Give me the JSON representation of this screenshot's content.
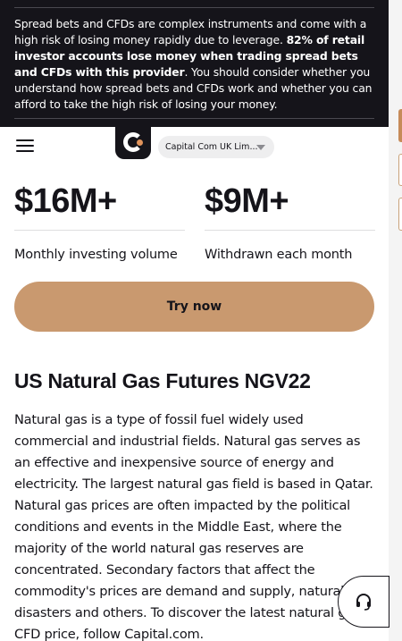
{
  "risk_banner": {
    "text_before": "Spread bets and CFDs are complex instruments and come with a high risk of losing money rapidly due to leverage. ",
    "bold_text": "82% of retail investor accounts lose money when trading spread bets and CFDs with this provider",
    "text_after": ". You should consider whether you understand how spread bets and CFDs work and whether you can afford to take the high risk of losing your money."
  },
  "header": {
    "menu_icon": "hamburger-menu-icon",
    "logo_icon": "capital-com-logo",
    "entity_select": "Capital Com UK Lim..."
  },
  "stats": [
    {
      "value": "$16M+",
      "label": "Monthly investing volume"
    },
    {
      "value": "$9M+",
      "label": "Withdrawn each month"
    }
  ],
  "cta": {
    "label": "Try now"
  },
  "article": {
    "title": "US Natural Gas Futures NGV22",
    "body": "Natural gas is a type of fossil fuel widely used commercial and industrial fields. Natural gas serves as an effective and inexpensive source of energy and electricity. The largest natural gas field is based in Qatar. Natural gas prices are often impacted by the political conditions and events in the Middle East, where the majority of the world natural gas reserves are concentrated. Secondary factors that affect the commodity's prices are demand and supply, natural disasters and others. To discover the latest natural gas CFD price, follow Capital.com."
  },
  "support": {
    "icon": "headset-icon"
  },
  "colors": {
    "banner_bg": "#15141a",
    "accent": "#c9996f",
    "logo_dot": "#e0935b"
  }
}
